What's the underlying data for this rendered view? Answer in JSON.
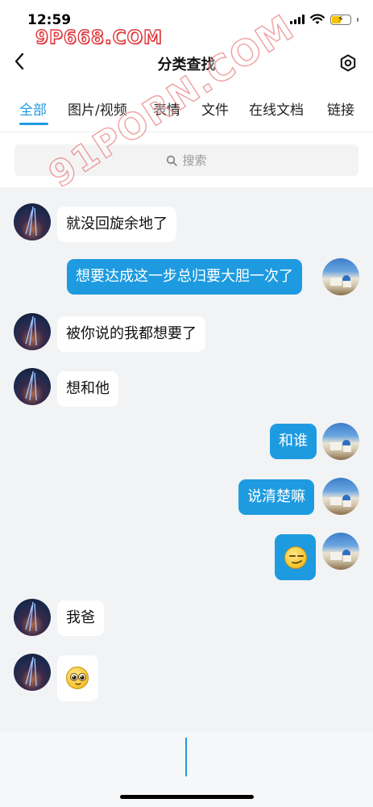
{
  "status_bar": {
    "time": "12:59"
  },
  "watermark": {
    "top_text": "9P668.COM",
    "diagonal_text": "91PORN.COM"
  },
  "nav": {
    "title": "分类查找"
  },
  "tabs": [
    {
      "label": "全部",
      "active": true
    },
    {
      "label": "图片/视频",
      "active": false
    },
    {
      "label": "表情",
      "active": false
    },
    {
      "label": "文件",
      "active": false
    },
    {
      "label": "在线文档",
      "active": false
    },
    {
      "label": "链接",
      "active": false
    }
  ],
  "search": {
    "placeholder": "搜索"
  },
  "messages": [
    {
      "side": "left",
      "text": "就没回旋余地了"
    },
    {
      "side": "right",
      "text": "想要达成这一步总归要大胆一次了"
    },
    {
      "side": "left",
      "text": "被你说的我都想要了"
    },
    {
      "side": "left",
      "text": "想和他"
    },
    {
      "side": "right",
      "text": "和谁"
    },
    {
      "side": "right",
      "text": "说清楚嘛"
    },
    {
      "side": "right",
      "text": "",
      "sticker": "smirk-emoji"
    },
    {
      "side": "left",
      "text": "我爸"
    },
    {
      "side": "left",
      "text": "",
      "sticker": "puppy-eyes-emoji"
    }
  ],
  "colors": {
    "accent": "#1e9be0",
    "bubble_in": "#ffffff",
    "background": "#f2f3f5"
  }
}
